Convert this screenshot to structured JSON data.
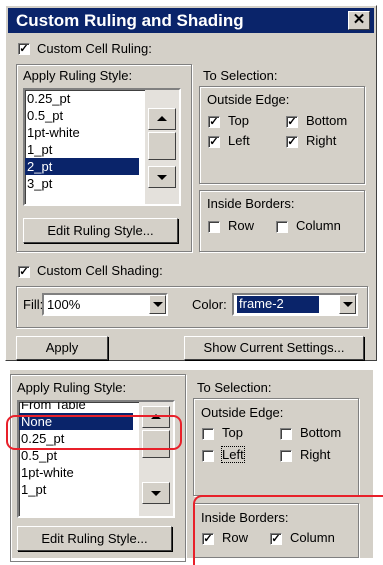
{
  "dialog": {
    "title": "Custom Ruling and Shading",
    "close_glyph": "✕"
  },
  "ruling": {
    "checkbox_label": "Custom Cell Ruling:",
    "checked": true,
    "apply_label": "Apply Ruling Style:",
    "styles": [
      "0.25_pt",
      "0.5_pt",
      "1pt-white",
      "1_pt",
      "2_pt",
      "3_pt"
    ],
    "selected": "2_pt",
    "edit_button": "Edit Ruling Style...",
    "to_selection": "To Selection:",
    "outside_edge": "Outside Edge:",
    "top": "Top",
    "bottom": "Bottom",
    "left": "Left",
    "right": "Right",
    "inside_borders": "Inside Borders:",
    "row": "Row",
    "column": "Column"
  },
  "shading": {
    "checkbox_label": "Custom Cell Shading:",
    "fill_label": "Fill:",
    "fill_value": "100%",
    "color_label": "Color:",
    "color_value": "frame-2"
  },
  "buttons": {
    "apply": "Apply",
    "show_current": "Show Current Settings..."
  },
  "panel2": {
    "apply_label": "Apply Ruling Style:",
    "styles": [
      "From Table",
      "None",
      "0.25_pt",
      "0.5_pt",
      "1pt-white",
      "1_pt"
    ],
    "selected": "None",
    "edit_button": "Edit Ruling Style...",
    "to_selection": "To Selection:",
    "outside_edge": "Outside Edge:",
    "top": "Top",
    "bottom": "Bottom",
    "left": "Left",
    "right": "Right",
    "inside_borders": "Inside Borders:",
    "row": "Row",
    "column": "Column"
  },
  "colors": {
    "title_bar": "#0a246a",
    "dialog_bg": "#d4d0c8",
    "highlight": "#e8202a"
  }
}
